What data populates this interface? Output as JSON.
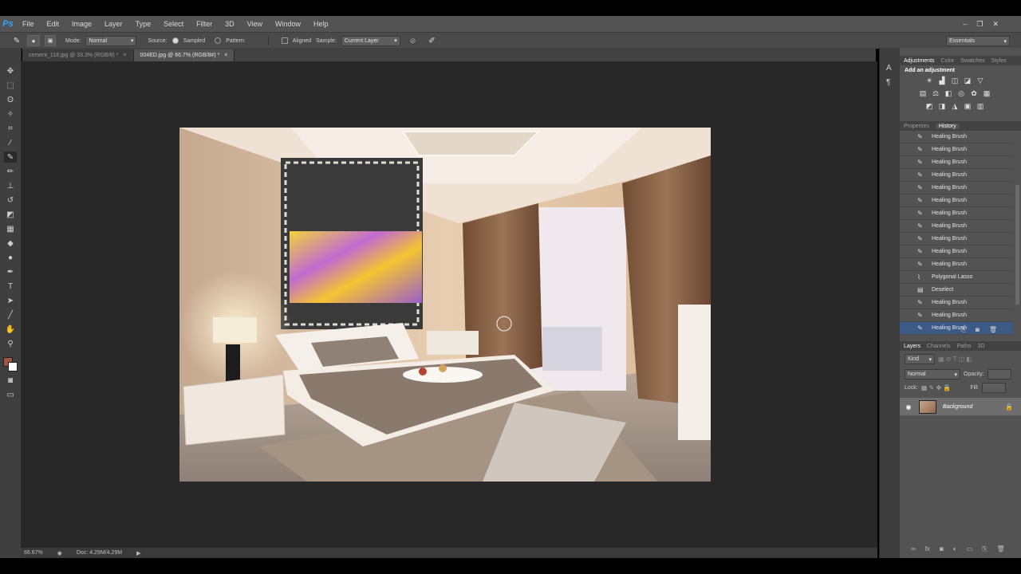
{
  "app": {
    "logo": "Ps"
  },
  "menu": [
    "File",
    "Edit",
    "Image",
    "Layer",
    "Type",
    "Select",
    "Filter",
    "3D",
    "View",
    "Window",
    "Help"
  ],
  "window_controls": [
    "–",
    "❐",
    "✕"
  ],
  "options": {
    "mode_label": "Mode:",
    "mode_value": "Normal",
    "source_label": "Source:",
    "sampled_label": "Sampled",
    "pattern_label": "Pattern:",
    "aligned_label": "Aligned",
    "sample_label": "Sample:",
    "sample_value": "Current Layer",
    "workspace": "Essentials"
  },
  "tabs": [
    {
      "label": "cement_118.jpg @ 33.3% (RGB/8) *",
      "active": false
    },
    {
      "label": "004ED.jpg @ 66.7% (RGB/8#) *",
      "active": true
    }
  ],
  "status": {
    "zoom": "66.67%",
    "doc": "Doc: 4.29M/4.29M"
  },
  "adjustments": {
    "tabs": [
      "Adjustments",
      "Color",
      "Swatches",
      "Styles"
    ],
    "heading": "Add an adjustment"
  },
  "history": {
    "tabs": [
      "Properties",
      "History"
    ],
    "items": [
      {
        "label": "Healing Brush",
        "icon": "brush"
      },
      {
        "label": "Healing Brush",
        "icon": "brush"
      },
      {
        "label": "Healing Brush",
        "icon": "brush"
      },
      {
        "label": "Healing Brush",
        "icon": "brush"
      },
      {
        "label": "Healing Brush",
        "icon": "brush"
      },
      {
        "label": "Healing Brush",
        "icon": "brush"
      },
      {
        "label": "Healing Brush",
        "icon": "brush"
      },
      {
        "label": "Healing Brush",
        "icon": "brush"
      },
      {
        "label": "Healing Brush",
        "icon": "brush"
      },
      {
        "label": "Healing Brush",
        "icon": "brush"
      },
      {
        "label": "Healing Brush",
        "icon": "brush"
      },
      {
        "label": "Polygonal Lasso",
        "icon": "lasso"
      },
      {
        "label": "Deselect",
        "icon": "doc"
      },
      {
        "label": "Healing Brush",
        "icon": "brush"
      },
      {
        "label": "Healing Brush",
        "icon": "brush"
      },
      {
        "label": "Healing Brush",
        "icon": "brush"
      }
    ]
  },
  "layers": {
    "tabs": [
      "Layers",
      "Channels",
      "Paths",
      "3D"
    ],
    "kind_label": "Kind",
    "blend_mode": "Normal",
    "opacity_label": "Opacity:",
    "lock_label": "Lock:",
    "fill_label": "Fill:",
    "layer_name": "Background"
  },
  "colors": {
    "foreground": "#a0533f",
    "background": "#ffffff",
    "selection": "#3d5a86"
  }
}
